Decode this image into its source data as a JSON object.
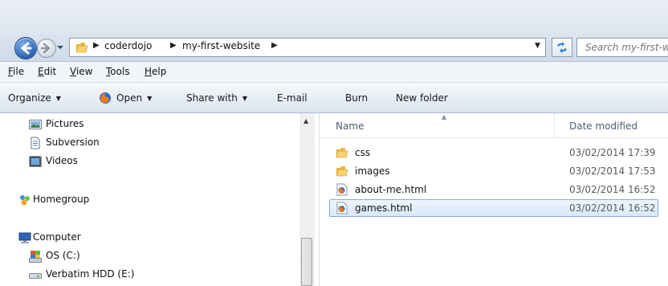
{
  "address": {
    "crumbs": [
      "coderdojo",
      "my-first-website"
    ],
    "search_placeholder": "Search my-first-website"
  },
  "menu": [
    {
      "mnemonic": "F",
      "rest": "ile"
    },
    {
      "mnemonic": "E",
      "rest": "dit"
    },
    {
      "mnemonic": "V",
      "rest": "iew"
    },
    {
      "mnemonic": "T",
      "rest": "ools"
    },
    {
      "mnemonic": "H",
      "rest": "elp"
    }
  ],
  "commands": {
    "organize": "Organize",
    "open": "Open",
    "share_with": "Share with",
    "email": "E-mail",
    "burn": "Burn",
    "new_folder": "New folder"
  },
  "nav": {
    "pictures": "Pictures",
    "subversion": "Subversion",
    "videos": "Videos",
    "homegroup": "Homegroup",
    "computer": "Computer",
    "os_drive": "OS (C:)",
    "verbatim": "Verbatim HDD (E:)"
  },
  "columns": {
    "name": "Name",
    "date_modified": "Date modified"
  },
  "files": [
    {
      "name": "css",
      "date": "03/02/2014 17:39",
      "icon": "folder-icon"
    },
    {
      "name": "images",
      "date": "03/02/2014 17:53",
      "icon": "folder-icon"
    },
    {
      "name": "about-me.html",
      "date": "03/02/2014 16:52",
      "icon": "firefox-html-icon"
    },
    {
      "name": "games.html",
      "date": "03/02/2014 16:52",
      "icon": "firefox-html-icon",
      "selected": true
    }
  ],
  "colors": {
    "selection_border": "#84acdd",
    "selection_fill": "#d9e8fa",
    "header_text": "#4c607a"
  }
}
